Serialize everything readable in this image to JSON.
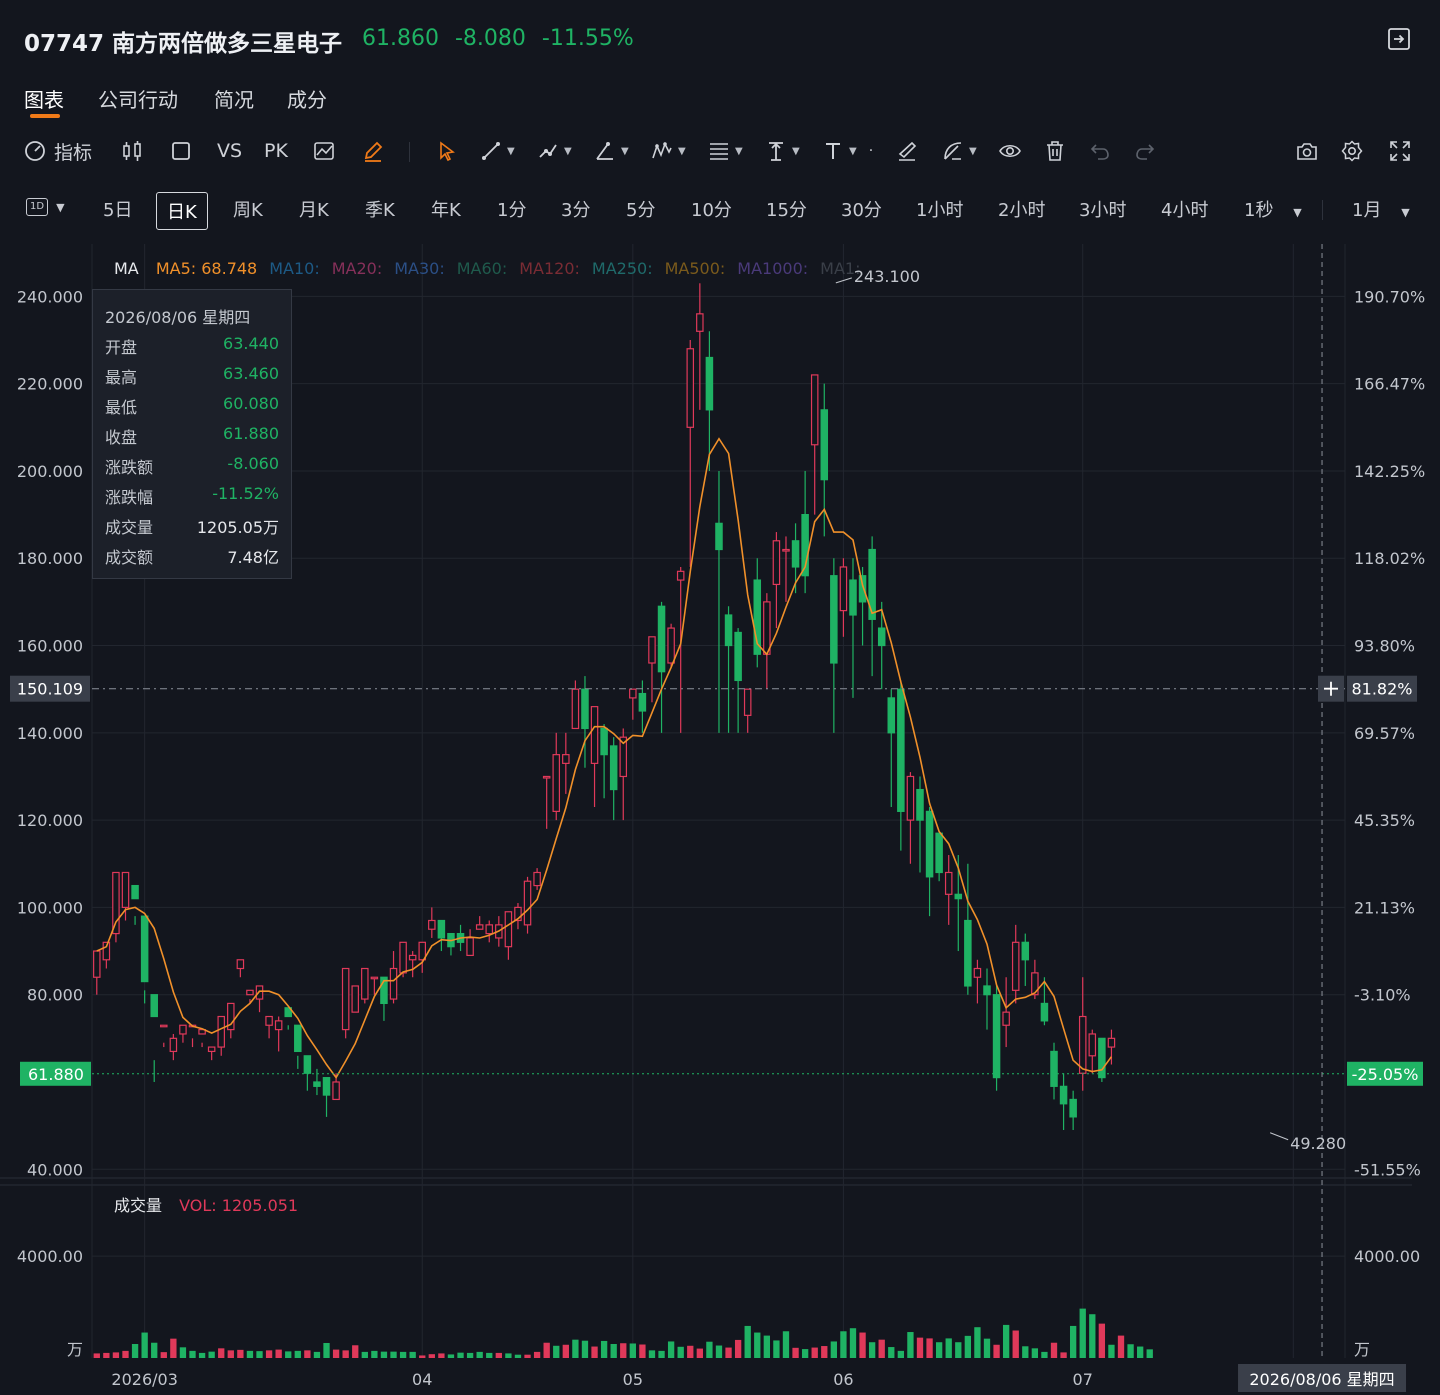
{
  "header": {
    "code": "07747",
    "name": "南方两倍做多三星电子",
    "price": "61.860",
    "change": "-8.080",
    "change_pct": "-11.55%"
  },
  "tabs": [
    {
      "label": "图表",
      "active": true
    },
    {
      "label": "公司行动",
      "active": false
    },
    {
      "label": "简况",
      "active": false
    },
    {
      "label": "成分",
      "active": false
    }
  ],
  "toolbar": {
    "indicator_label": "指标",
    "vs_label": "VS",
    "pk_label": "PK",
    "tools": [
      "indicator-icon",
      "candle-type-icon",
      "rectangle-icon",
      "compare-icon",
      "pencil-icon",
      "cursor-icon",
      "line-tool-icon",
      "path-tool-icon",
      "angle-tool-icon",
      "wave-tool-icon",
      "fib-tool-icon",
      "vertical-line-icon",
      "text-tool-icon",
      "brush-tool-icon",
      "measure-tool-icon",
      "eye-icon",
      "trash-icon",
      "undo-icon",
      "redo-icon",
      "camera-icon",
      "settings-icon",
      "fullscreen-icon"
    ]
  },
  "periods": {
    "type_label": "1D",
    "items": [
      {
        "label": "5日",
        "active": false
      },
      {
        "label": "日K",
        "active": true
      },
      {
        "label": "周K",
        "active": false
      },
      {
        "label": "月K",
        "active": false
      },
      {
        "label": "季K",
        "active": false
      },
      {
        "label": "年K",
        "active": false
      },
      {
        "label": "1分",
        "active": false
      },
      {
        "label": "3分",
        "active": false
      },
      {
        "label": "5分",
        "active": false
      },
      {
        "label": "10分",
        "active": false
      },
      {
        "label": "15分",
        "active": false
      },
      {
        "label": "30分",
        "active": false
      },
      {
        "label": "1小时",
        "active": false
      },
      {
        "label": "2小时",
        "active": false
      },
      {
        "label": "3小时",
        "active": false
      },
      {
        "label": "4小时",
        "active": false
      }
    ],
    "seconds_label": "1秒",
    "range_label": "1月"
  },
  "ma_legend": {
    "title": "MA",
    "items": [
      {
        "label": "MA5: 68.748",
        "color": "#f0902a"
      },
      {
        "label": "MA10:",
        "color": "#1d5a86"
      },
      {
        "label": "MA20:",
        "color": "#86305a"
      },
      {
        "label": "MA30:",
        "color": "#2b4f86"
      },
      {
        "label": "MA60:",
        "color": "#1f5a4c"
      },
      {
        "label": "MA120:",
        "color": "#7a2c34"
      },
      {
        "label": "MA250:",
        "color": "#1f6a6a"
      },
      {
        "label": "MA500:",
        "color": "#7a5a1c"
      },
      {
        "label": "MA1000:",
        "color": "#4a3a7a"
      },
      {
        "label": "MA1:",
        "color": "#3a3f48"
      }
    ]
  },
  "tooltip": {
    "date": "2026/08/06 星期四",
    "rows": [
      {
        "k": "开盘",
        "v": "63.440",
        "tone": "green"
      },
      {
        "k": "最高",
        "v": "63.460",
        "tone": "green"
      },
      {
        "k": "最低",
        "v": "60.080",
        "tone": "green"
      },
      {
        "k": "收盘",
        "v": "61.880",
        "tone": "green"
      },
      {
        "k": "涨跌额",
        "v": "-8.060",
        "tone": "green"
      },
      {
        "k": "涨跌幅",
        "v": "-11.52%",
        "tone": "green"
      },
      {
        "k": "成交量",
        "v": "1205.05万",
        "tone": "white"
      },
      {
        "k": "成交额",
        "v": "7.48亿",
        "tone": "white"
      }
    ]
  },
  "volume_legend": {
    "title": "成交量",
    "value_label": "VOL: 1205.051"
  },
  "colors": {
    "up": "#e0395a",
    "down": "#1fb364",
    "ma5": "#f0902a",
    "grid": "#22262f",
    "axis_text": "#c2c6cd",
    "crosshair": "#8b909a"
  },
  "chart_data": {
    "type": "candlestick",
    "y_ticks": [
      "240.000",
      "220.000",
      "200.000",
      "180.000",
      "160.000",
      "140.000",
      "120.000",
      "100.000",
      "80.000",
      "40.000"
    ],
    "y_tick_values": [
      240,
      220,
      200,
      180,
      160,
      140,
      120,
      100,
      80,
      40
    ],
    "pct_ticks": [
      "190.70%",
      "166.47%",
      "142.25%",
      "118.02%",
      "93.80%",
      "69.57%",
      "45.35%",
      "21.13%",
      "-3.10%",
      "-51.55%"
    ],
    "pct_tick_values": [
      240,
      220,
      200,
      180,
      160,
      140,
      120,
      100,
      80,
      40
    ],
    "ylim": [
      38,
      252
    ],
    "vol_ticks": [
      "4000.00"
    ],
    "vol_unit": "万",
    "vol_ylim": [
      0,
      5500
    ],
    "x_labels": [
      {
        "label": "2026/03",
        "index": 5
      },
      {
        "label": "04",
        "index": 34
      },
      {
        "label": "05",
        "index": 56
      },
      {
        "label": "06",
        "index": 78
      },
      {
        "label": "07",
        "index": 103
      }
    ],
    "crosshair": {
      "price_label": "150.109",
      "price": 150.109,
      "pct_label": "81.82%",
      "date_label": "2026/08/06 星期四",
      "index": 128
    },
    "last_price": {
      "label": "61.880",
      "price": 61.88,
      "pct_label": "-25.05%"
    },
    "annotations": [
      {
        "label": "243.100",
        "price": 243.1,
        "index": 77
      },
      {
        "label": "49.280",
        "price": 49.28,
        "index": 123
      }
    ],
    "count": 129,
    "candles": [
      [
        84,
        90,
        80,
        88
      ],
      [
        88,
        92,
        86,
        91
      ],
      [
        94,
        108,
        92,
        106
      ],
      [
        100,
        108,
        97,
        106
      ],
      [
        105,
        102,
        96,
        98
      ],
      [
        98,
        83,
        78,
        81
      ],
      [
        80,
        75,
        60,
        65
      ],
      [
        73,
        73,
        68,
        69
      ],
      [
        67,
        70,
        65,
        71
      ],
      [
        71,
        73,
        69,
        72
      ],
      [
        73,
        73,
        68,
        70
      ],
      [
        71,
        72,
        68,
        69
      ],
      [
        67,
        68,
        65,
        68
      ],
      [
        68,
        75,
        66,
        72
      ],
      [
        72,
        78,
        70,
        78
      ],
      [
        86,
        88,
        84,
        88
      ],
      [
        80,
        81,
        78,
        79
      ],
      [
        79,
        82,
        76,
        80
      ],
      [
        73,
        75,
        70,
        73
      ],
      [
        72,
        74,
        67,
        75
      ],
      [
        77,
        75,
        72,
        73
      ],
      [
        73,
        67,
        63,
        66
      ],
      [
        66,
        62,
        58,
        63
      ],
      [
        60,
        59,
        57,
        63
      ],
      [
        61,
        57,
        52,
        57
      ],
      [
        56,
        60,
        56,
        62
      ],
      [
        72,
        86,
        70,
        84
      ],
      [
        76,
        82,
        76,
        79
      ],
      [
        79,
        86,
        78,
        85
      ],
      [
        84,
        84,
        80,
        84
      ],
      [
        84,
        78,
        74,
        79
      ],
      [
        79,
        86,
        78,
        90
      ],
      [
        85,
        92,
        84,
        88
      ],
      [
        88,
        89,
        84,
        90
      ],
      [
        88,
        92,
        85,
        92
      ],
      [
        95,
        97,
        93,
        100
      ],
      [
        97,
        93,
        90,
        96
      ],
      [
        94,
        91,
        89,
        94
      ],
      [
        94,
        92,
        90,
        96
      ],
      [
        89,
        93,
        89,
        95
      ],
      [
        95,
        96,
        95,
        98
      ],
      [
        94,
        96,
        92,
        97
      ],
      [
        93,
        96,
        91,
        98
      ],
      [
        91,
        99,
        88,
        99
      ],
      [
        97,
        100,
        95,
        101
      ],
      [
        96,
        106,
        94,
        107
      ],
      [
        105,
        108,
        104,
        109
      ],
      [
        130,
        130,
        118,
        130
      ],
      [
        122,
        135,
        120,
        140
      ],
      [
        133,
        135,
        126,
        140
      ],
      [
        141,
        150,
        146,
        152
      ],
      [
        150,
        141,
        132,
        153
      ],
      [
        133,
        146,
        123,
        145
      ],
      [
        141,
        135,
        125,
        142
      ],
      [
        137,
        127,
        120,
        139
      ],
      [
        130,
        139,
        120,
        141
      ],
      [
        148,
        150,
        143,
        150
      ],
      [
        149,
        145,
        140,
        152
      ],
      [
        156,
        162,
        147,
        162
      ],
      [
        169,
        154,
        140,
        170
      ],
      [
        156,
        164,
        155,
        165
      ],
      [
        175,
        177,
        140,
        178
      ],
      [
        210,
        228,
        178,
        230
      ],
      [
        232,
        236,
        214,
        243
      ],
      [
        226,
        214,
        200,
        232
      ],
      [
        188,
        182,
        140,
        200
      ],
      [
        167,
        160,
        140,
        169
      ],
      [
        163,
        152,
        140,
        164
      ],
      [
        144,
        150,
        140,
        150
      ],
      [
        175,
        158,
        155,
        180
      ],
      [
        158,
        170,
        150,
        172
      ],
      [
        174,
        184,
        164,
        186
      ],
      [
        182,
        182,
        170,
        185
      ],
      [
        184,
        178,
        172,
        188
      ],
      [
        190,
        176,
        172,
        200
      ],
      [
        206,
        222,
        190,
        222
      ],
      [
        214,
        198,
        185,
        220
      ],
      [
        176,
        156,
        140,
        180
      ],
      [
        168,
        178,
        162,
        180
      ],
      [
        175,
        167,
        148,
        180
      ],
      [
        176,
        170,
        160,
        178
      ],
      [
        182,
        166,
        153,
        185
      ],
      [
        164,
        160,
        150,
        170
      ],
      [
        148,
        140,
        123,
        150
      ],
      [
        150,
        122,
        113,
        152
      ],
      [
        120,
        130,
        110,
        131
      ],
      [
        127,
        120,
        108,
        130
      ],
      [
        122,
        107,
        98,
        123
      ],
      [
        117,
        108,
        106,
        117
      ],
      [
        103,
        108,
        96,
        112
      ],
      [
        103,
        102,
        90,
        112
      ],
      [
        97,
        82,
        80,
        110
      ],
      [
        84,
        86,
        78,
        88
      ],
      [
        82,
        80,
        72,
        86
      ],
      [
        80,
        61,
        58,
        82
      ],
      [
        73,
        76,
        68,
        84
      ],
      [
        81,
        92,
        78,
        96
      ],
      [
        92,
        88,
        82,
        94
      ],
      [
        80,
        85,
        79,
        88
      ],
      [
        78,
        74,
        73,
        84
      ],
      [
        67,
        59,
        56,
        69
      ],
      [
        59,
        55,
        49,
        62
      ],
      [
        56,
        52,
        49,
        58
      ],
      [
        62,
        75,
        58,
        84
      ],
      [
        66,
        71,
        62,
        72
      ],
      [
        70,
        61,
        60,
        69
      ],
      [
        68,
        70,
        64,
        72
      ]
    ],
    "volume": [
      [
        180,
        "up"
      ],
      [
        200,
        "up"
      ],
      [
        220,
        "up"
      ],
      [
        280,
        "up"
      ],
      [
        550,
        "down"
      ],
      [
        1000,
        "down"
      ],
      [
        600,
        "down"
      ],
      [
        230,
        "up"
      ],
      [
        760,
        "up"
      ],
      [
        420,
        "down"
      ],
      [
        280,
        "down"
      ],
      [
        200,
        "down"
      ],
      [
        250,
        "down"
      ],
      [
        380,
        "up"
      ],
      [
        300,
        "up"
      ],
      [
        320,
        "up"
      ],
      [
        280,
        "down"
      ],
      [
        270,
        "down"
      ],
      [
        300,
        "up"
      ],
      [
        330,
        "up"
      ],
      [
        260,
        "down"
      ],
      [
        280,
        "down"
      ],
      [
        300,
        "up"
      ],
      [
        240,
        "down"
      ],
      [
        590,
        "down"
      ],
      [
        330,
        "up"
      ],
      [
        300,
        "up"
      ],
      [
        500,
        "up"
      ],
      [
        240,
        "down"
      ],
      [
        280,
        "down"
      ],
      [
        250,
        "down"
      ],
      [
        250,
        "down"
      ],
      [
        240,
        "down"
      ],
      [
        240,
        "down"
      ],
      [
        100,
        "up"
      ],
      [
        150,
        "up"
      ],
      [
        180,
        "up"
      ],
      [
        140,
        "down"
      ],
      [
        210,
        "down"
      ],
      [
        200,
        "down"
      ],
      [
        240,
        "down"
      ],
      [
        200,
        "down"
      ],
      [
        200,
        "up"
      ],
      [
        180,
        "down"
      ],
      [
        130,
        "down"
      ],
      [
        130,
        "up"
      ],
      [
        240,
        "up"
      ],
      [
        600,
        "up"
      ],
      [
        480,
        "down"
      ],
      [
        520,
        "up"
      ],
      [
        720,
        "down"
      ],
      [
        680,
        "down"
      ],
      [
        450,
        "up"
      ],
      [
        670,
        "down"
      ],
      [
        550,
        "down"
      ],
      [
        580,
        "up"
      ],
      [
        570,
        "down"
      ],
      [
        530,
        "up"
      ],
      [
        300,
        "down"
      ],
      [
        280,
        "down"
      ],
      [
        650,
        "down"
      ],
      [
        440,
        "down"
      ],
      [
        480,
        "up"
      ],
      [
        370,
        "up"
      ],
      [
        640,
        "down"
      ],
      [
        490,
        "down"
      ],
      [
        410,
        "up"
      ],
      [
        710,
        "up"
      ],
      [
        1260,
        "down"
      ],
      [
        1000,
        "down"
      ],
      [
        880,
        "down"
      ],
      [
        690,
        "down"
      ],
      [
        1050,
        "down"
      ],
      [
        400,
        "up"
      ],
      [
        350,
        "down"
      ],
      [
        410,
        "up"
      ],
      [
        470,
        "up"
      ],
      [
        650,
        "down"
      ],
      [
        1050,
        "down"
      ],
      [
        1170,
        "down"
      ],
      [
        1000,
        "up"
      ],
      [
        620,
        "down"
      ],
      [
        720,
        "up"
      ],
      [
        430,
        "down"
      ],
      [
        280,
        "down"
      ],
      [
        1020,
        "down"
      ],
      [
        800,
        "up"
      ],
      [
        770,
        "up"
      ],
      [
        620,
        "down"
      ],
      [
        770,
        "down"
      ],
      [
        620,
        "down"
      ],
      [
        870,
        "down"
      ],
      [
        1210,
        "down"
      ],
      [
        760,
        "down"
      ],
      [
        520,
        "up"
      ],
      [
        1300,
        "down"
      ],
      [
        1080,
        "up"
      ],
      [
        460,
        "down"
      ],
      [
        380,
        "down"
      ],
      [
        240,
        "down"
      ],
      [
        600,
        "up"
      ],
      [
        220,
        "up"
      ],
      [
        1260,
        "down"
      ],
      [
        1940,
        "down"
      ],
      [
        1720,
        "down"
      ],
      [
        1350,
        "up"
      ],
      [
        520,
        "down"
      ],
      [
        880,
        "up"
      ],
      [
        540,
        "down"
      ],
      [
        450,
        "down"
      ],
      [
        340,
        "down"
      ]
    ]
  }
}
